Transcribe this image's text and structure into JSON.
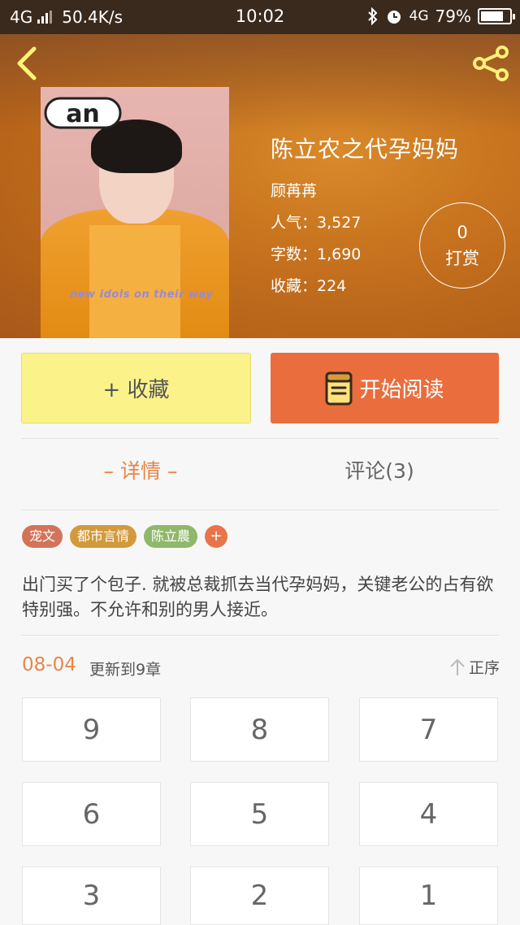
{
  "status_bar": {
    "network": "4G",
    "speed": "50.4K/s",
    "time": "10:02",
    "network_right": "4G",
    "battery": "79%",
    "battery_level": 0.79
  },
  "book": {
    "title": "陈立农之代孕妈妈",
    "author": "顾苒苒",
    "popularity": "人气：3,527",
    "word_count": "字数：1,690",
    "favorites": "收藏：224",
    "tip_count": "0",
    "tip_label": "打赏",
    "cover_logo": "an",
    "cover_text": "new idols on their way"
  },
  "actions": {
    "collect": "+ 收藏",
    "read": "开始阅读"
  },
  "tabs": {
    "detail": "– 详情 –",
    "comments": "评论(3)"
  },
  "tags": [
    {
      "label": "宠文",
      "color": "#d2745a"
    },
    {
      "label": "都市言情",
      "color": "#d29a3c"
    },
    {
      "label": "陈立農",
      "color": "#8fb86a"
    }
  ],
  "tag_add": "+",
  "synopsis": "出门买了个包子. 就被总裁抓去当代孕妈妈，关键老公的占有欲特别强。不允许和别的男人接近。",
  "update": {
    "date": "08-04",
    "text": "更新到9章",
    "order": "正序"
  },
  "chapters": [
    "9",
    "8",
    "7",
    "6",
    "5",
    "4",
    "3",
    "2",
    "1"
  ],
  "colors": {
    "accent": "#e8854a",
    "read_button": "#ea6d3e",
    "collect_button": "#fbf38a",
    "header": "#c8741f"
  }
}
